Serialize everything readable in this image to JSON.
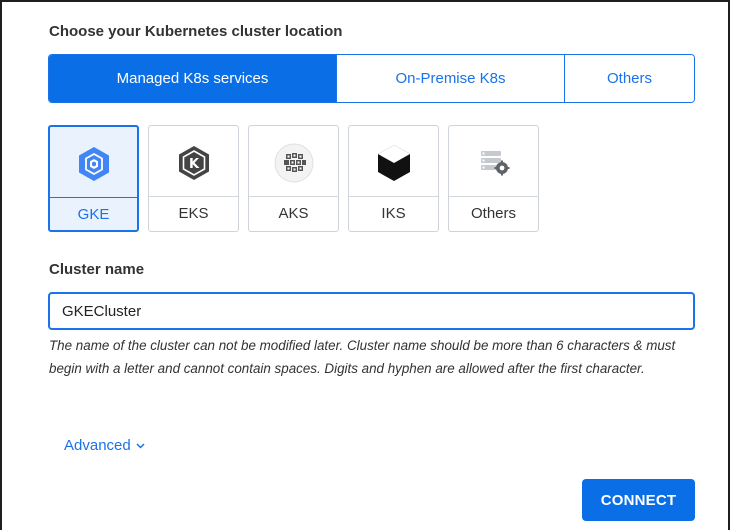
{
  "section_title": "Choose your Kubernetes cluster location",
  "location_tabs": [
    {
      "label": "Managed K8s services",
      "active": true
    },
    {
      "label": "On-Premise K8s",
      "active": false
    },
    {
      "label": "Others",
      "active": false
    }
  ],
  "providers": [
    {
      "label": "GKE",
      "icon": "gke-icon",
      "selected": true
    },
    {
      "label": "EKS",
      "icon": "eks-icon",
      "selected": false
    },
    {
      "label": "AKS",
      "icon": "aks-icon",
      "selected": false
    },
    {
      "label": "IKS",
      "icon": "iks-icon",
      "selected": false
    },
    {
      "label": "Others",
      "icon": "others-server-icon",
      "selected": false
    }
  ],
  "cluster_name": {
    "label": "Cluster name",
    "value": "GKECluster",
    "help": "The name of the cluster can not be modified later. Cluster name should be more than 6 characters & must begin with a letter and cannot contain spaces. Digits and hyphen are allowed after the first character."
  },
  "advanced": {
    "label": "Advanced",
    "icon": "chevron-down-icon"
  },
  "connect_button": {
    "label": "CONNECT"
  },
  "colors": {
    "accent": "#0a6fe6",
    "text": "#333333",
    "border": "#cfd4da"
  }
}
